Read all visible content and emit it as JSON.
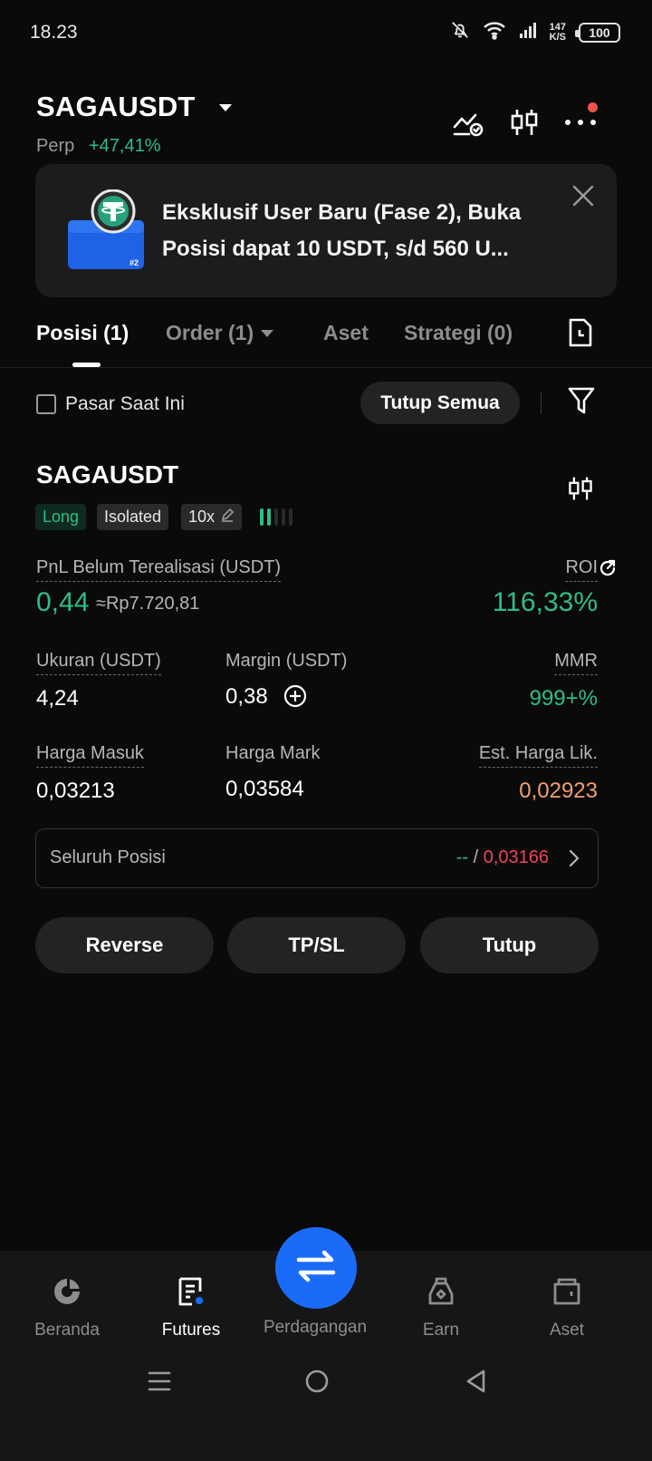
{
  "status_bar": {
    "time": "18.23",
    "net_speed_value": "147",
    "net_speed_unit": "K/S",
    "battery": "100"
  },
  "header": {
    "pair": "SAGAUSDT",
    "type": "Perp",
    "change": "+47,41%"
  },
  "banner": {
    "text": "Eksklusif User Baru (Fase 2), Buka Posisi dapat 10 USDT, s/d 560 U...",
    "badge": "#2"
  },
  "tabs": [
    {
      "label": "Posisi (1)"
    },
    {
      "label": "Order (1)"
    },
    {
      "label": "Aset"
    },
    {
      "label": "Strategi (0)"
    }
  ],
  "filter": {
    "current_market_label": "Pasar Saat Ini",
    "close_all_label": "Tutup Semua"
  },
  "position": {
    "symbol": "SAGAUSDT",
    "side": "Long",
    "margin_mode": "Isolated",
    "leverage": "10x",
    "adl_level": 2,
    "pnl_label": "PnL Belum Terealisasi (USDT)",
    "pnl_value": "0,44",
    "pnl_idr": "≈Rp7.720,81",
    "roi_label": "ROI",
    "roi_value": "116,33%",
    "size_label": "Ukuran (USDT)",
    "size_value": "4,24",
    "margin_label": "Margin (USDT)",
    "margin_value": "0,38",
    "mmr_label": "MMR",
    "mmr_value": "999+%",
    "entry_label": "Harga Masuk",
    "entry_value": "0,03213",
    "mark_label": "Harga Mark",
    "mark_value": "0,03584",
    "liq_label": "Est. Harga Lik.",
    "liq_value": "0,02923",
    "all_position_label": "Seluruh Posisi",
    "all_tp": "--",
    "all_sep": "/",
    "all_sl": "0,03166"
  },
  "actions": {
    "reverse": "Reverse",
    "tpsl": "TP/SL",
    "close": "Tutup"
  },
  "bottom_nav": [
    {
      "label": "Beranda"
    },
    {
      "label": "Futures"
    },
    {
      "label": "Perdagangan"
    },
    {
      "label": "Earn"
    },
    {
      "label": "Aset"
    }
  ],
  "colors": {
    "green": "#2ebd85",
    "red": "#f0415d",
    "orange": "#f0a070",
    "accent_blue": "#1a6cf8"
  },
  "icons": [
    "bell-off-icon",
    "wifi-icon",
    "signal-icon",
    "battery-icon",
    "chart-alert-icon",
    "candlestick-icon",
    "more-icon",
    "close-icon",
    "history-icon",
    "filter-icon",
    "edit-icon",
    "roi-refresh-icon",
    "plus-circle-icon",
    "chevron-right-icon",
    "home-icon",
    "futures-icon",
    "trade-icon",
    "earn-icon",
    "wallet-icon",
    "menu-icon",
    "home-circle-icon",
    "back-icon"
  ]
}
